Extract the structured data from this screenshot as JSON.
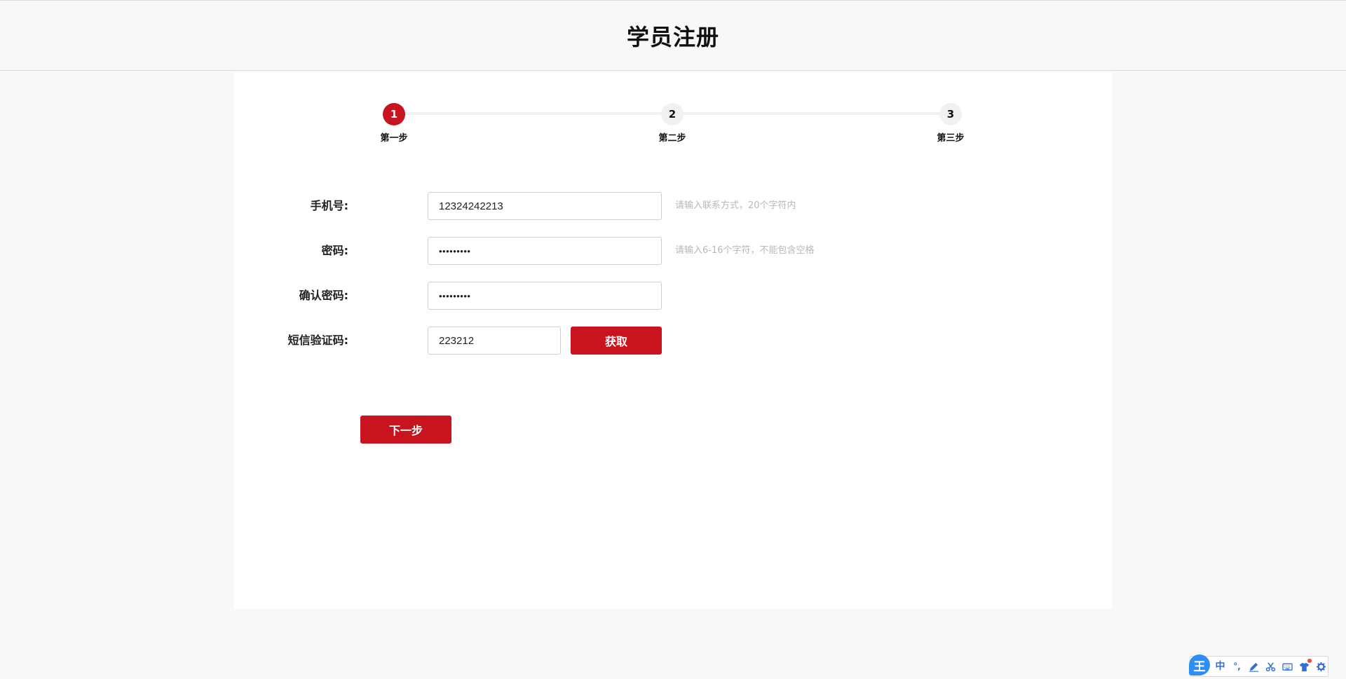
{
  "page": {
    "title": "学员注册"
  },
  "stepper": {
    "steps": [
      {
        "number": "1",
        "label": "第一步"
      },
      {
        "number": "2",
        "label": "第二步"
      },
      {
        "number": "3",
        "label": "第三步"
      }
    ],
    "active_index": 0
  },
  "form": {
    "phone": {
      "label": "手机号:",
      "value": "12324242213",
      "hint": "请输入联系方式，20个字符内"
    },
    "password": {
      "label": "密码:",
      "value": "123456789",
      "hint": "请输入6-16个字符，不能包含空格"
    },
    "confirm_password": {
      "label": "确认密码:",
      "value": "123456789"
    },
    "sms_code": {
      "label": "短信验证码:",
      "value": "223212",
      "button_label": "获取"
    },
    "next_label": "下一步"
  },
  "ime_toolbar": {
    "logo": "王",
    "items": [
      "中",
      "°,",
      "pen-icon",
      "scissors-icon",
      "keyboard-icon",
      "shirt-icon",
      "gear-icon"
    ]
  },
  "colors": {
    "accent": "#c8141f",
    "background": "#f8f8f8",
    "panel": "#ffffff",
    "hint": "#b8b8b8"
  }
}
